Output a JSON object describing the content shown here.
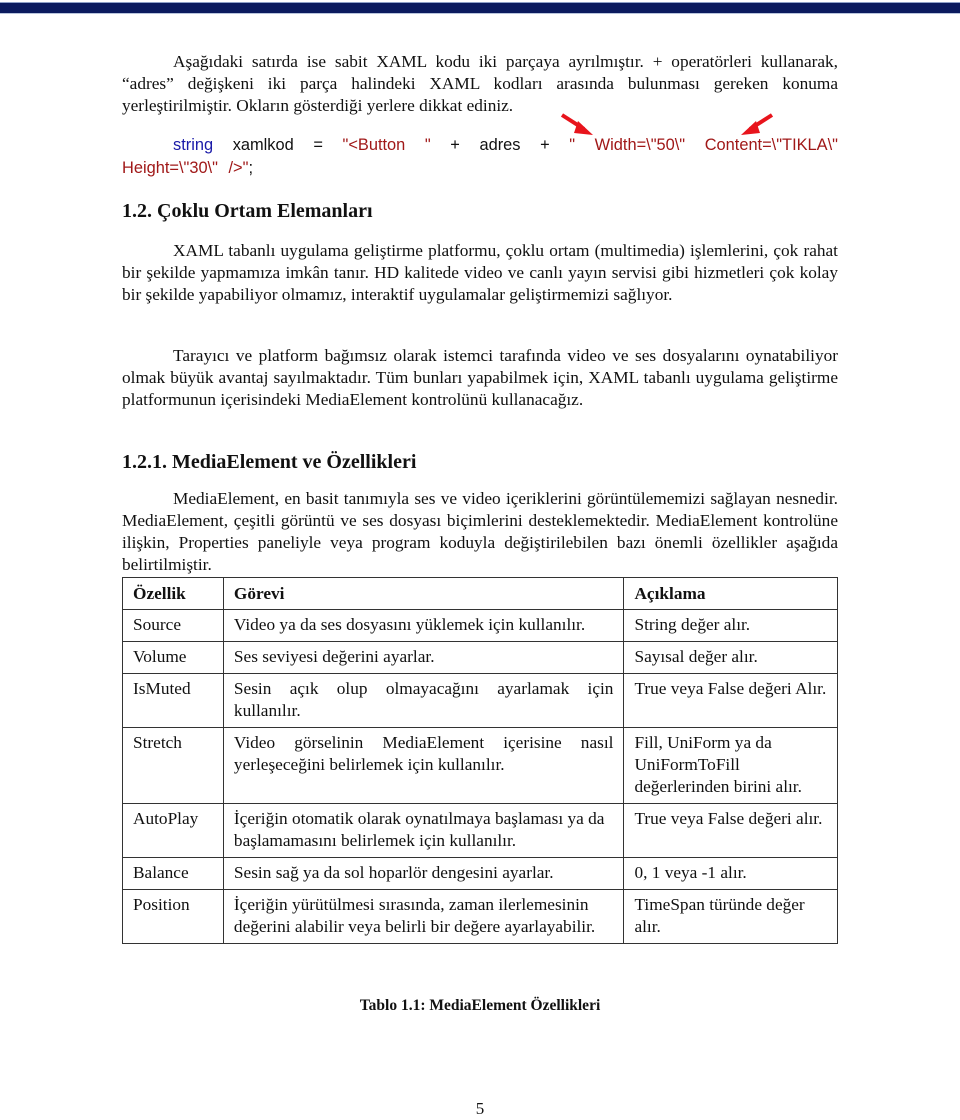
{
  "header": {
    "bar_color": "#0b1a5e"
  },
  "intro": {
    "text": "Aşağıdaki satırda ise sabit XAML kodu iki parçaya ayrılmıştır. + operatörleri kullanarak, “adres” değişkeni iki parça halindeki XAML kodları arasında bulunması gereken konuma yerleştirilmiştir. Okların gösterdiği yerlere dikkat ediniz."
  },
  "code_line": {
    "keyword": "string",
    "var_decl": " xamlkod = ",
    "str1": "\"<Button \"",
    "concat1": " + adres + ",
    "str2": "\" Width=\\\"50\\\" Content=\\\"TIKLA\\\" Height=\\\"30\\\" />\"",
    "end": ";",
    "colors": {
      "keyword": "#1a1aa8",
      "string": "#a01818",
      "arrow": "#e8141c"
    },
    "arrows": [
      "arrow-pointing-to-Width",
      "arrow-pointing-to-Content"
    ]
  },
  "section_1_2": {
    "heading": "1.2. Çoklu Ortam Elemanları",
    "paragraphs": [
      "XAML tabanlı uygulama geliştirme platformu, çoklu ortam (multimedia) işlemlerini, çok rahat bir şekilde yapmamıza imkân tanır. HD kalitede video ve canlı yayın servisi gibi hizmetleri çok kolay bir şekilde yapabiliyor olmamız,  interaktif uygulamalar geliştirmemizi sağlıyor.",
      "Tarayıcı ve platform bağımsız olarak istemci tarafında video ve ses dosyalarını oynatabiliyor olmak büyük avantaj sayılmaktadır. Tüm bunları yapabilmek için, XAML tabanlı uygulama geliştirme platformunun içerisindeki MediaElement kontrolünü kullanacağız."
    ]
  },
  "section_1_2_1": {
    "heading": "1.2.1. MediaElement ve Özellikleri",
    "paragraph": "MediaElement, en basit tanımıyla ses ve video içeriklerini görüntülememizi sağlayan nesnedir. MediaElement, çeşitli görüntü ve ses dosyası biçimlerini desteklemektedir. MediaElement kontrolüne ilişkin, Properties paneliyle veya program koduyla değiştirilebilen bazı önemli özellikler aşağıda belirtilmiştir."
  },
  "table": {
    "headers": [
      "Özellik",
      "Görevi",
      "Açıklama"
    ],
    "rows": [
      [
        "Source",
        "Video ya da ses dosyasını yüklemek için kullanılır.",
        "String değer alır."
      ],
      [
        "Volume",
        "Ses seviyesi değerini ayarlar.",
        "Sayısal değer alır."
      ],
      [
        "IsMuted",
        "Sesin açık olup olmayacağını ayarlamak için kullanılır.",
        "True veya False değeri Alır."
      ],
      [
        "Stretch",
        "Video görselinin MediaElement içerisine nasıl yerleşeceğini belirlemek için kullanılır.",
        "Fill, UniForm ya da UniFormToFill değerlerinden birini alır."
      ],
      [
        "AutoPlay",
        "İçeriğin otomatik olarak oynatılmaya başlaması ya da başlamamasını belirlemek için kullanılır.",
        "True veya False değeri alır."
      ],
      [
        "Balance",
        "Sesin sağ ya da sol hoparlör dengesini ayarlar.",
        "0, 1 veya -1 alır."
      ],
      [
        "Position",
        "İçeriğin yürütülmesi sırasında,  zaman ilerlemesinin değerini alabilir veya belirli bir değere ayarlayabilir.",
        "TimeSpan türünde değer alır."
      ]
    ],
    "caption": "Tablo 1.1: MediaElement Özellikleri"
  },
  "footer": {
    "page_number": "5"
  }
}
